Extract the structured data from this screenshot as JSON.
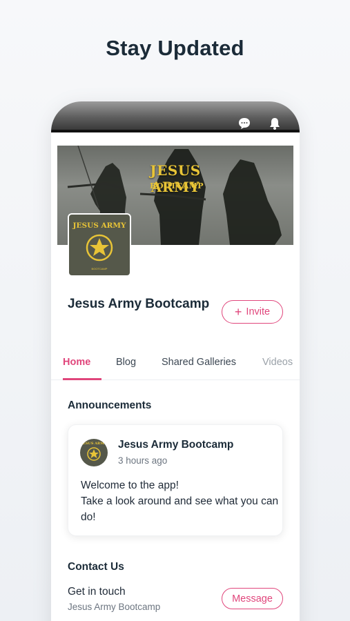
{
  "headline": "Stay Updated",
  "phone": {
    "top_icons": [
      "chat-bubble-icon",
      "bell-icon"
    ],
    "cover": {
      "title": "JESUS ARMY",
      "subtitle": "BOOTCAMP"
    },
    "logo": {
      "title": "JESUS ARMY",
      "subtitle": "BOOTCAMP"
    },
    "group_name": "Jesus Army Bootcamp",
    "invite_label": "Invite",
    "invite_icon": "+",
    "tabs": [
      {
        "label": "Home",
        "active": true
      },
      {
        "label": "Blog"
      },
      {
        "label": "Shared Galleries"
      },
      {
        "label": "Videos"
      }
    ],
    "announcements": {
      "title": "Announcements",
      "post": {
        "author": "Jesus Army Bootcamp",
        "time": "3 hours ago",
        "line1": "Welcome to the app!",
        "line2": "Take a look around and see what you can do!"
      }
    },
    "contact": {
      "title": "Contact Us",
      "line1": "Get in touch",
      "line2": "Jesus Army Bootcamp",
      "button": "Message"
    }
  },
  "colors": {
    "accent": "#e0457b",
    "text": "#1b2b38",
    "gold": "#e8c437"
  }
}
